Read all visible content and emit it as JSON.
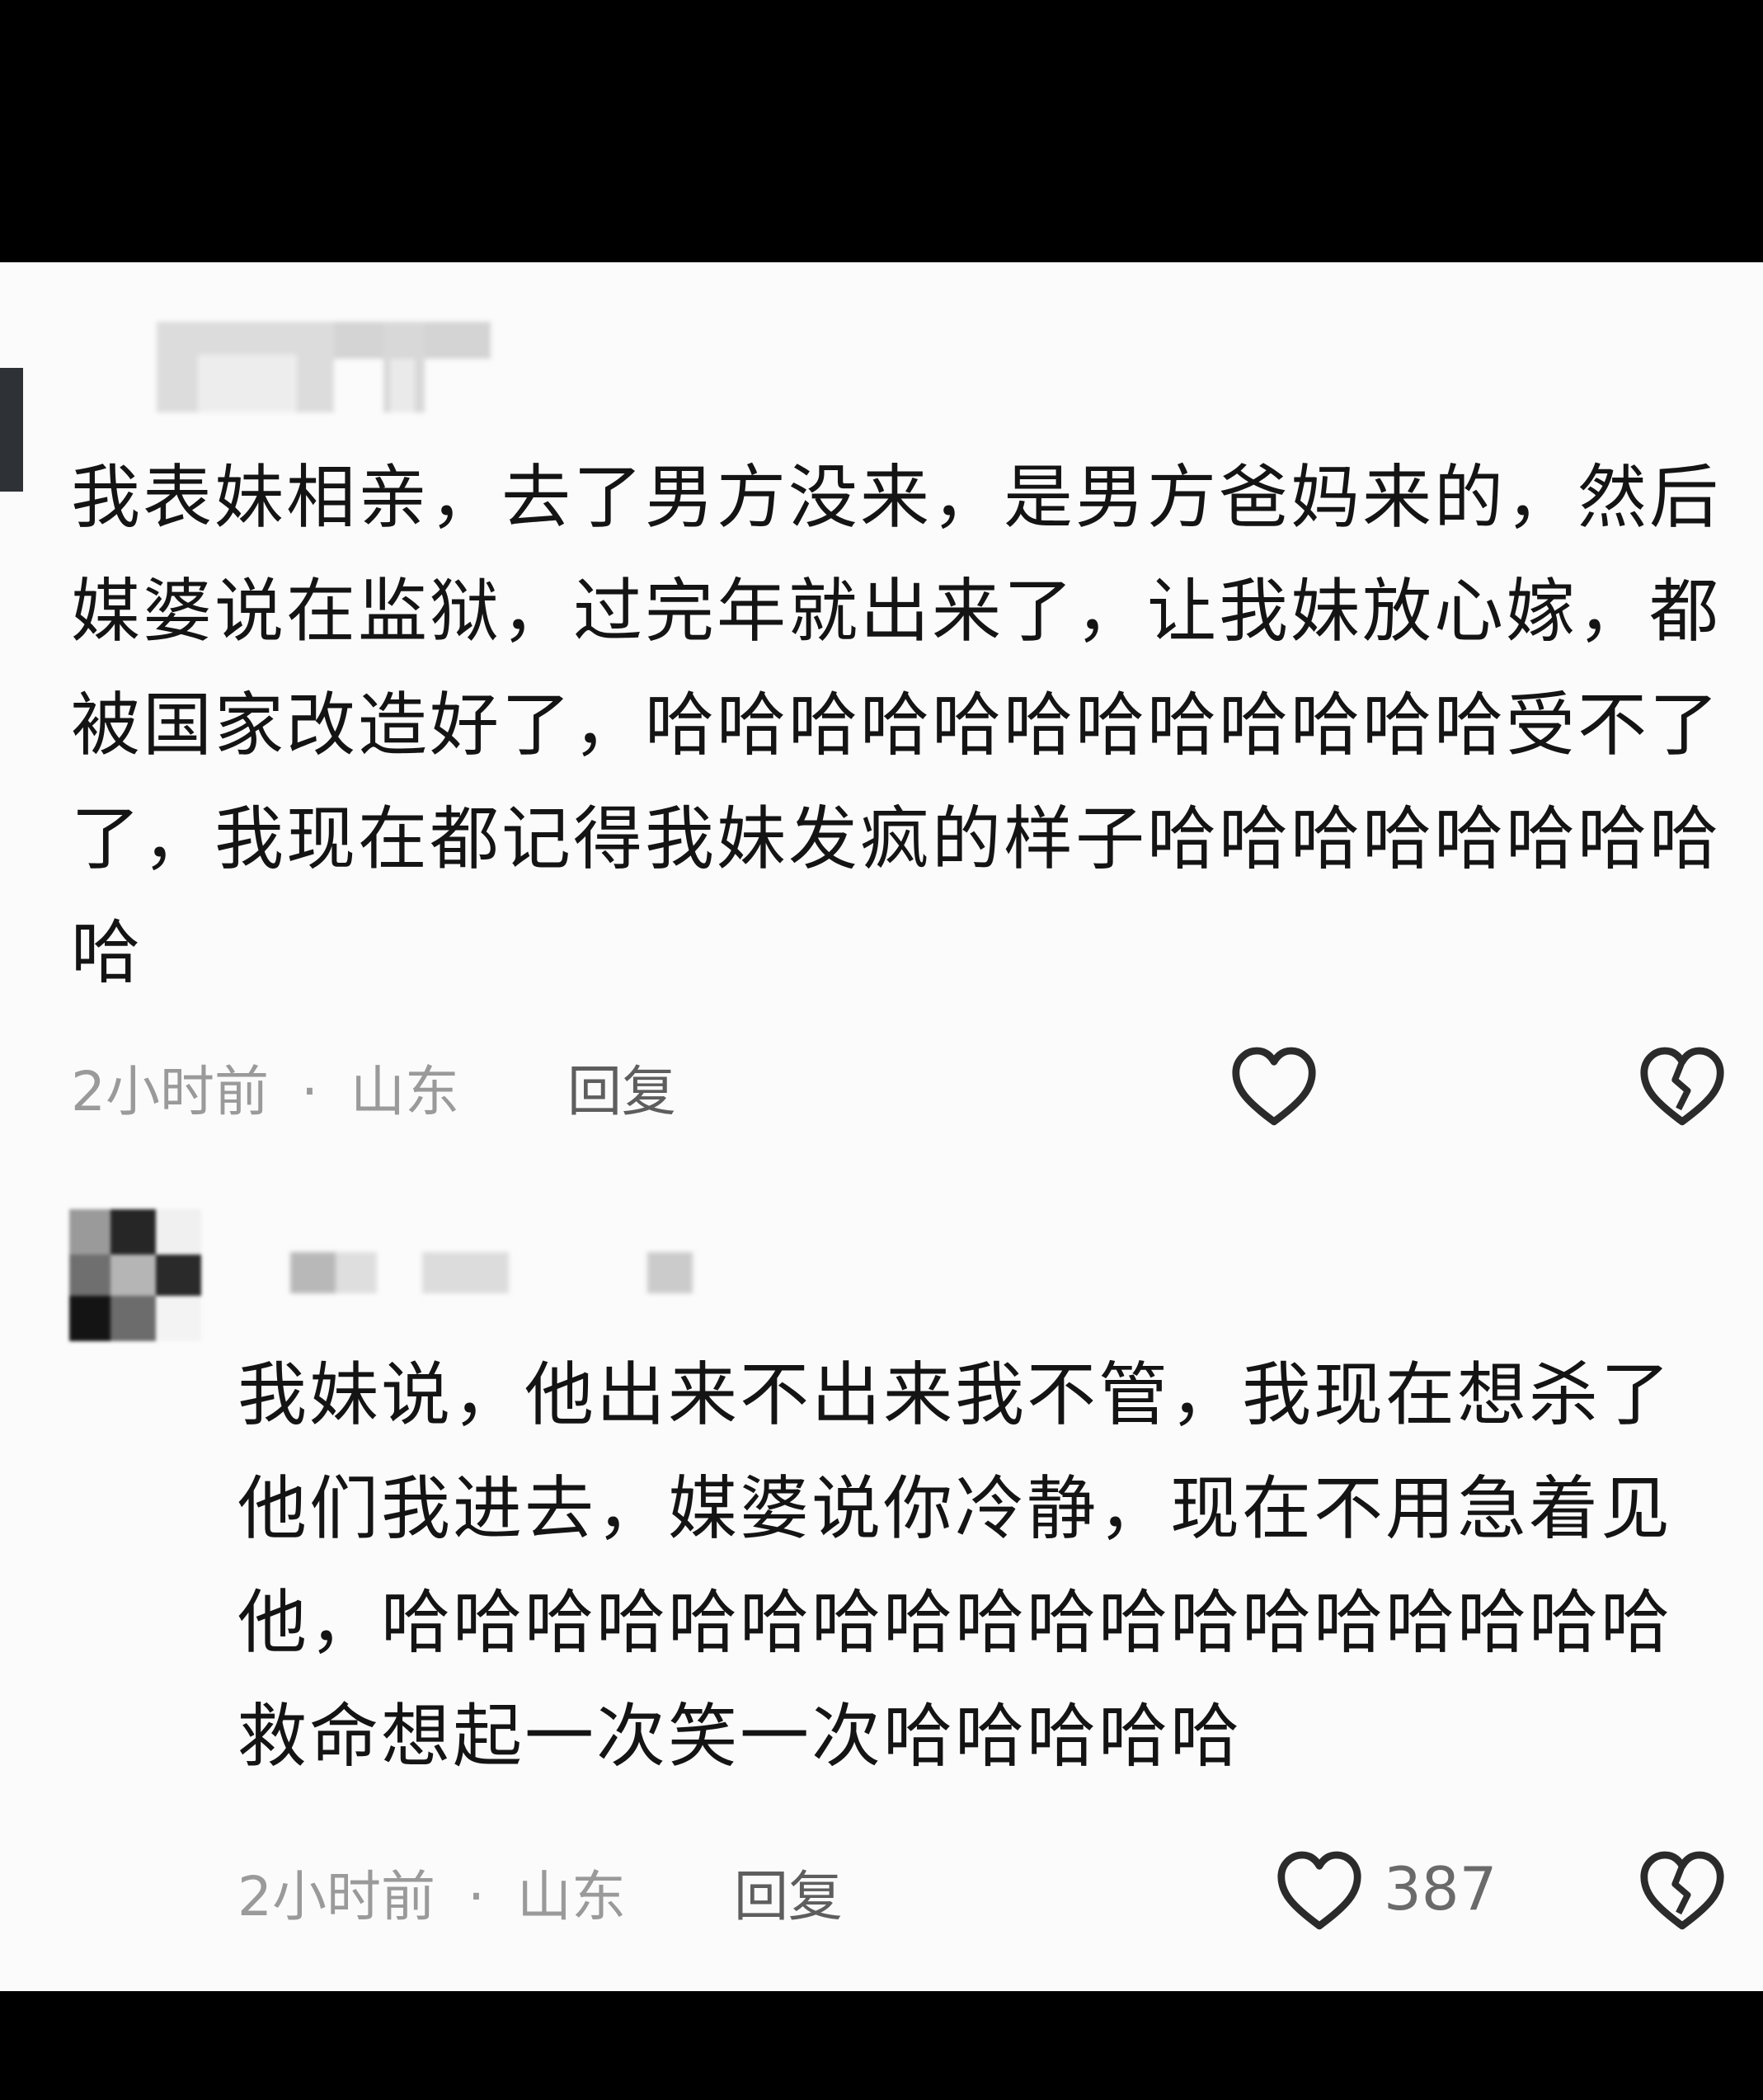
{
  "comments": [
    {
      "text": "我表妹相亲，去了男方没来，是男方爸妈来的，然后媒婆说在监狱，过完年就出来了，让我妹放心嫁，都被国家改造好了，哈哈哈哈哈哈哈哈哈哈哈哈受不了了，我现在都记得我妹发疯的样子哈哈哈哈哈哈哈哈哈",
      "time": "2小时前",
      "location": "山东",
      "separator": "·",
      "reply_label": "回复",
      "like_icon": "heart-outline-icon",
      "dislike_icon": "broken-heart-icon"
    },
    {
      "text": "我妹说，他出来不出来我不管，我现在想杀了他们我进去，媒婆说你冷静，现在不用急着见他，哈哈哈哈哈哈哈哈哈哈哈哈哈哈哈哈哈哈救命想起一次笑一次哈哈哈哈哈",
      "time": "2小时前",
      "location": "山东",
      "separator": "·",
      "reply_label": "回复",
      "like_count": "387",
      "like_icon": "heart-outline-icon",
      "dislike_icon": "broken-heart-icon"
    }
  ]
}
